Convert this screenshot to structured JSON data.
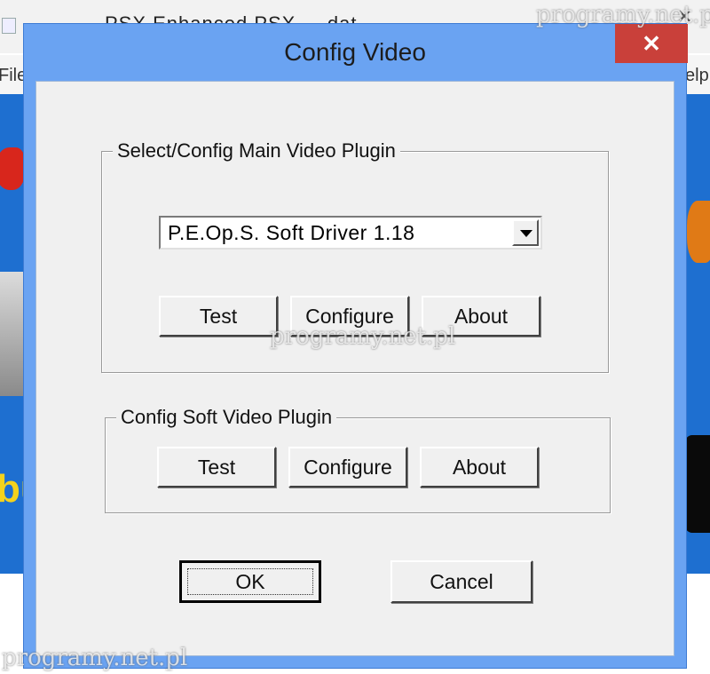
{
  "background_window": {
    "title": "PSX    Enhanced PSX    ... dat",
    "menu_left": "File",
    "menu_right": "elp",
    "close_glyph": "✕"
  },
  "dialog": {
    "title": "Config Video",
    "close_glyph": "✕",
    "main_group": {
      "legend": "Select/Config Main Video Plugin",
      "plugin_select_value": "P.E.Op.S. Soft Driver 1.18",
      "test_label": "Test",
      "configure_label": "Configure",
      "about_label": "About"
    },
    "soft_group": {
      "legend": "Config Soft Video Plugin",
      "test_label": "Test",
      "configure_label": "Configure",
      "about_label": "About"
    },
    "ok_label": "OK",
    "cancel_label": "Cancel"
  },
  "watermarks": {
    "top_right": "programy.net.pl",
    "center": "programy.net.pl",
    "bottom_left": "programy.net.pl"
  },
  "colors": {
    "dialog_border_blue": "#6aa3f2",
    "close_button_red": "#c9403a",
    "dialog_face": "#f0f0f0",
    "banner_blue": "#1e6fd0"
  },
  "icons": [
    "app-icon",
    "close-icon",
    "dropdown-arrow-icon"
  ]
}
